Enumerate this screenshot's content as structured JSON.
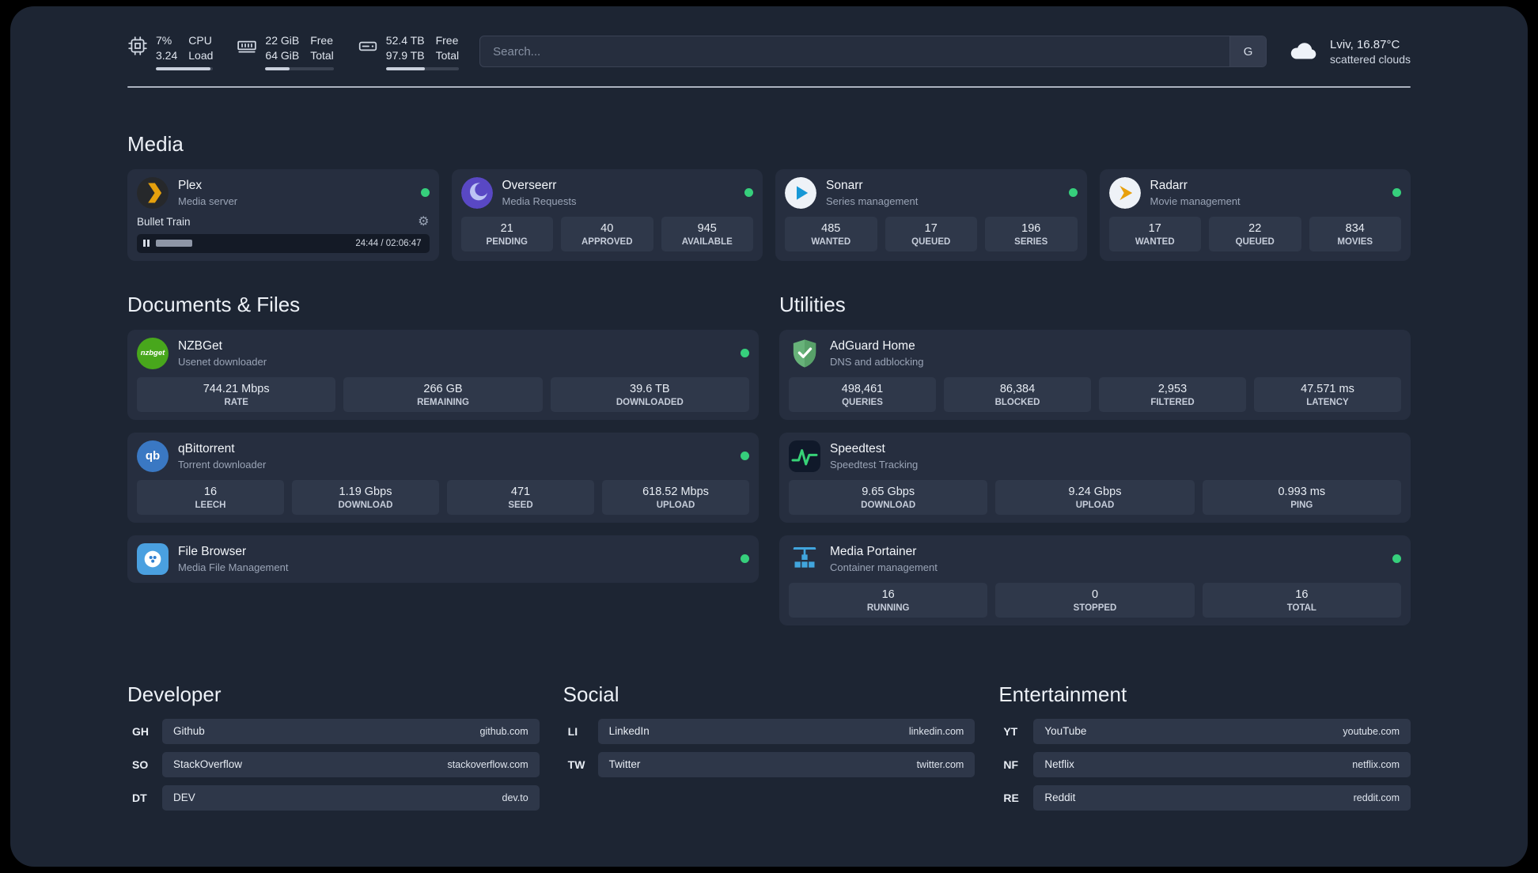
{
  "topbar": {
    "cpu": {
      "value_top": "7%",
      "label_top": "CPU",
      "value_bottom": "3.24",
      "label_bottom": "Load",
      "fill_pct": 95
    },
    "memory": {
      "value_top": "22 GiB",
      "label_top": "Free",
      "value_bottom": "64 GiB",
      "label_bottom": "Total",
      "fill_pct": 35
    },
    "disk": {
      "value_top": "52.4 TB",
      "label_top": "Free",
      "value_bottom": "97.9 TB",
      "label_bottom": "Total",
      "fill_pct": 53
    },
    "search": {
      "placeholder": "Search...",
      "button_label": "G"
    },
    "weather": {
      "location": "Lviv, 16.87°C",
      "condition": "scattered clouds"
    }
  },
  "sections": {
    "media": {
      "title": "Media"
    },
    "documents": {
      "title": "Documents & Files"
    },
    "utilities": {
      "title": "Utilities"
    },
    "developer": {
      "title": "Developer"
    },
    "social": {
      "title": "Social"
    },
    "entertainment": {
      "title": "Entertainment"
    }
  },
  "services": {
    "plex": {
      "name": "Plex",
      "desc": "Media server",
      "now_playing": "Bullet Train",
      "time": "24:44 / 02:06:47",
      "progress_pct": 19
    },
    "overseerr": {
      "name": "Overseerr",
      "desc": "Media Requests",
      "stats": [
        {
          "value": "21",
          "label": "PENDING"
        },
        {
          "value": "40",
          "label": "APPROVED"
        },
        {
          "value": "945",
          "label": "AVAILABLE"
        }
      ]
    },
    "sonarr": {
      "name": "Sonarr",
      "desc": "Series management",
      "stats": [
        {
          "value": "485",
          "label": "WANTED"
        },
        {
          "value": "17",
          "label": "QUEUED"
        },
        {
          "value": "196",
          "label": "SERIES"
        }
      ]
    },
    "radarr": {
      "name": "Radarr",
      "desc": "Movie management",
      "stats": [
        {
          "value": "17",
          "label": "WANTED"
        },
        {
          "value": "22",
          "label": "QUEUED"
        },
        {
          "value": "834",
          "label": "MOVIES"
        }
      ]
    },
    "nzbget": {
      "name": "NZBGet",
      "desc": "Usenet downloader",
      "icon_text": "nzbget",
      "stats": [
        {
          "value": "744.21 Mbps",
          "label": "RATE"
        },
        {
          "value": "266 GB",
          "label": "REMAINING"
        },
        {
          "value": "39.6 TB",
          "label": "DOWNLOADED"
        }
      ]
    },
    "qbittorrent": {
      "name": "qBittorrent",
      "desc": "Torrent downloader",
      "icon_text": "qb",
      "stats": [
        {
          "value": "16",
          "label": "LEECH"
        },
        {
          "value": "1.19 Gbps",
          "label": "DOWNLOAD"
        },
        {
          "value": "471",
          "label": "SEED"
        },
        {
          "value": "618.52 Mbps",
          "label": "UPLOAD"
        }
      ]
    },
    "filebrowser": {
      "name": "File Browser",
      "desc": "Media File Management"
    },
    "adguard": {
      "name": "AdGuard Home",
      "desc": "DNS and adblocking",
      "stats": [
        {
          "value": "498,461",
          "label": "QUERIES"
        },
        {
          "value": "86,384",
          "label": "BLOCKED"
        },
        {
          "value": "2,953",
          "label": "FILTERED"
        },
        {
          "value": "47.571 ms",
          "label": "LATENCY"
        }
      ]
    },
    "speedtest": {
      "name": "Speedtest",
      "desc": "Speedtest Tracking",
      "stats": [
        {
          "value": "9.65 Gbps",
          "label": "DOWNLOAD"
        },
        {
          "value": "9.24 Gbps",
          "label": "UPLOAD"
        },
        {
          "value": "0.993 ms",
          "label": "PING"
        }
      ]
    },
    "portainer": {
      "name": "Media Portainer",
      "desc": "Container management",
      "stats": [
        {
          "value": "16",
          "label": "RUNNING"
        },
        {
          "value": "0",
          "label": "STOPPED"
        },
        {
          "value": "16",
          "label": "TOTAL"
        }
      ]
    }
  },
  "bookmarks": {
    "developer": [
      {
        "abbr": "GH",
        "name": "Github",
        "url": "github.com"
      },
      {
        "abbr": "SO",
        "name": "StackOverflow",
        "url": "stackoverflow.com"
      },
      {
        "abbr": "DT",
        "name": "DEV",
        "url": "dev.to"
      }
    ],
    "social": [
      {
        "abbr": "LI",
        "name": "LinkedIn",
        "url": "linkedin.com"
      },
      {
        "abbr": "TW",
        "name": "Twitter",
        "url": "twitter.com"
      }
    ],
    "entertainment": [
      {
        "abbr": "YT",
        "name": "YouTube",
        "url": "youtube.com"
      },
      {
        "abbr": "NF",
        "name": "Netflix",
        "url": "netflix.com"
      },
      {
        "abbr": "RE",
        "name": "Reddit",
        "url": "reddit.com"
      }
    ]
  },
  "colors": {
    "status_online": "#36cf7c"
  }
}
